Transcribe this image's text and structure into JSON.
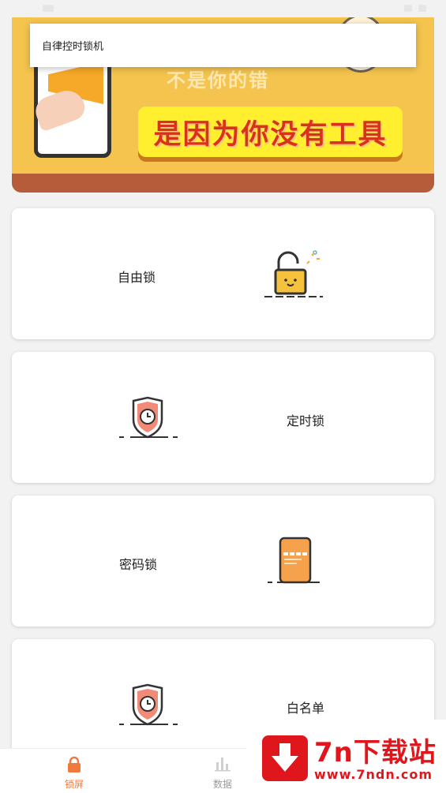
{
  "app": {
    "title": "自律控时锁机"
  },
  "banner": {
    "sub_slogan": "不是你的错",
    "slogan": "是因为你没有工具"
  },
  "cards": [
    {
      "label": "自由锁",
      "icon": "padlock-open-icon"
    },
    {
      "label": "定时锁",
      "icon": "shield-clock-icon"
    },
    {
      "label": "密码锁",
      "icon": "phone-password-icon"
    },
    {
      "label": "白名单",
      "icon": "shield-clock-icon"
    }
  ],
  "bottom_nav": {
    "items": [
      {
        "label": "锁屏",
        "icon": "lock-icon",
        "active": true
      },
      {
        "label": "数据",
        "icon": "bar-chart-icon",
        "active": false
      }
    ]
  },
  "watermark": {
    "title": "7n下载站",
    "url": "www.7ndn.com"
  },
  "colors": {
    "accent": "#f07a3d",
    "banner": "#f4c44e",
    "watermark": "#e0161d"
  }
}
